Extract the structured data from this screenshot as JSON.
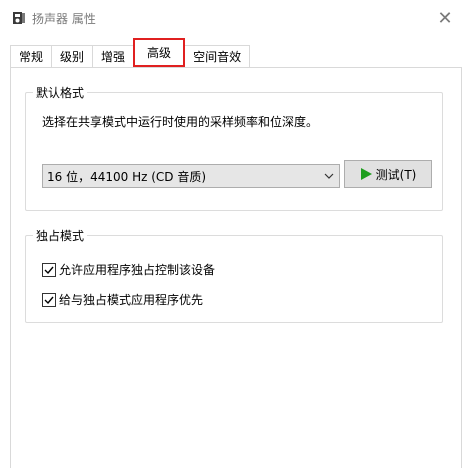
{
  "window": {
    "title": "扬声器 属性",
    "close_glyph": "✕"
  },
  "tabs": [
    {
      "label": "常规",
      "active": false
    },
    {
      "label": "级别",
      "active": false
    },
    {
      "label": "增强",
      "active": false
    },
    {
      "label": "高级",
      "active": true
    },
    {
      "label": "空间音效",
      "active": false
    }
  ],
  "default_format": {
    "group_label": "默认格式",
    "description": "选择在共享模式中运行时使用的采样频率和位深度。",
    "selected_format": "16 位，44100 Hz (CD 音质)",
    "test_button_label": "测试(T)"
  },
  "exclusive_mode": {
    "group_label": "独占模式",
    "options": [
      {
        "label": "允许应用程序独占控制该设备",
        "checked": true
      },
      {
        "label": "给与独占模式应用程序优先",
        "checked": true
      }
    ]
  },
  "colors": {
    "active_tab_highlight": "#e02020",
    "play_icon": "#1e9e1e"
  }
}
